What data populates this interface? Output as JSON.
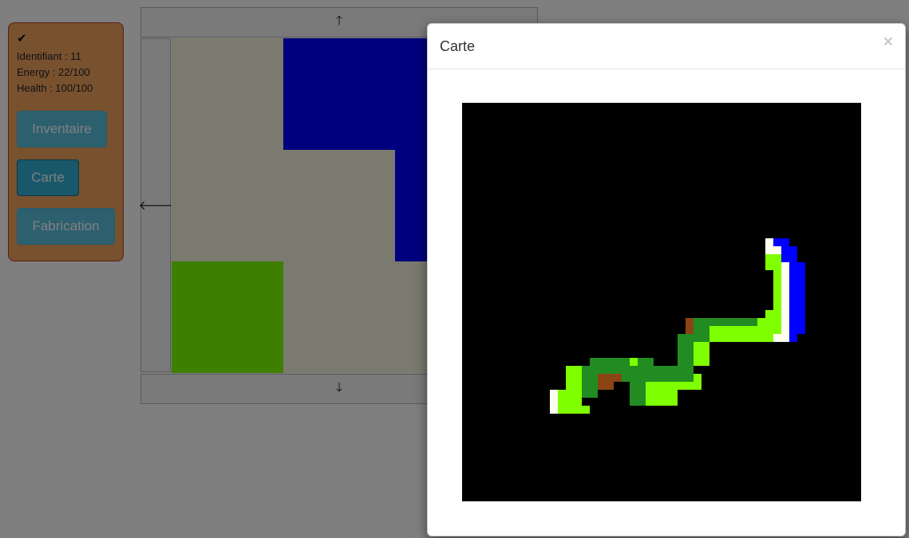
{
  "player": {
    "status_icon": "check-icon",
    "status_glyph": "✔",
    "identifiant": "Identifiant : 11",
    "energy": "Energy : 22/100",
    "health": "Health : 100/100"
  },
  "buttons": {
    "inventaire": "Inventaire",
    "carte": "Carte",
    "fabrication": "Fabrication"
  },
  "navigation": {
    "up_icon": "arrow-up-icon",
    "down_icon": "arrow-down-icon",
    "left_icon": "arrow-left-icon",
    "up_glyph": "🡑",
    "down_glyph": "🡓",
    "left_glyph": "🡐"
  },
  "colors": {
    "panel_bg": "#f0a25f",
    "panel_border": "#c0392b",
    "button_info": "#5bc0de",
    "button_active": "#31b0d5",
    "tile_sand": "#f5f5dc",
    "tile_water": "#0000ff",
    "tile_grass": "#7fff00",
    "tile_forest": "#228b22",
    "tile_dirt": "#8b4513",
    "tile_snow": "#fffff0"
  },
  "modal": {
    "title": "Carte",
    "close_glyph": "×",
    "close_icon": "close-icon"
  }
}
